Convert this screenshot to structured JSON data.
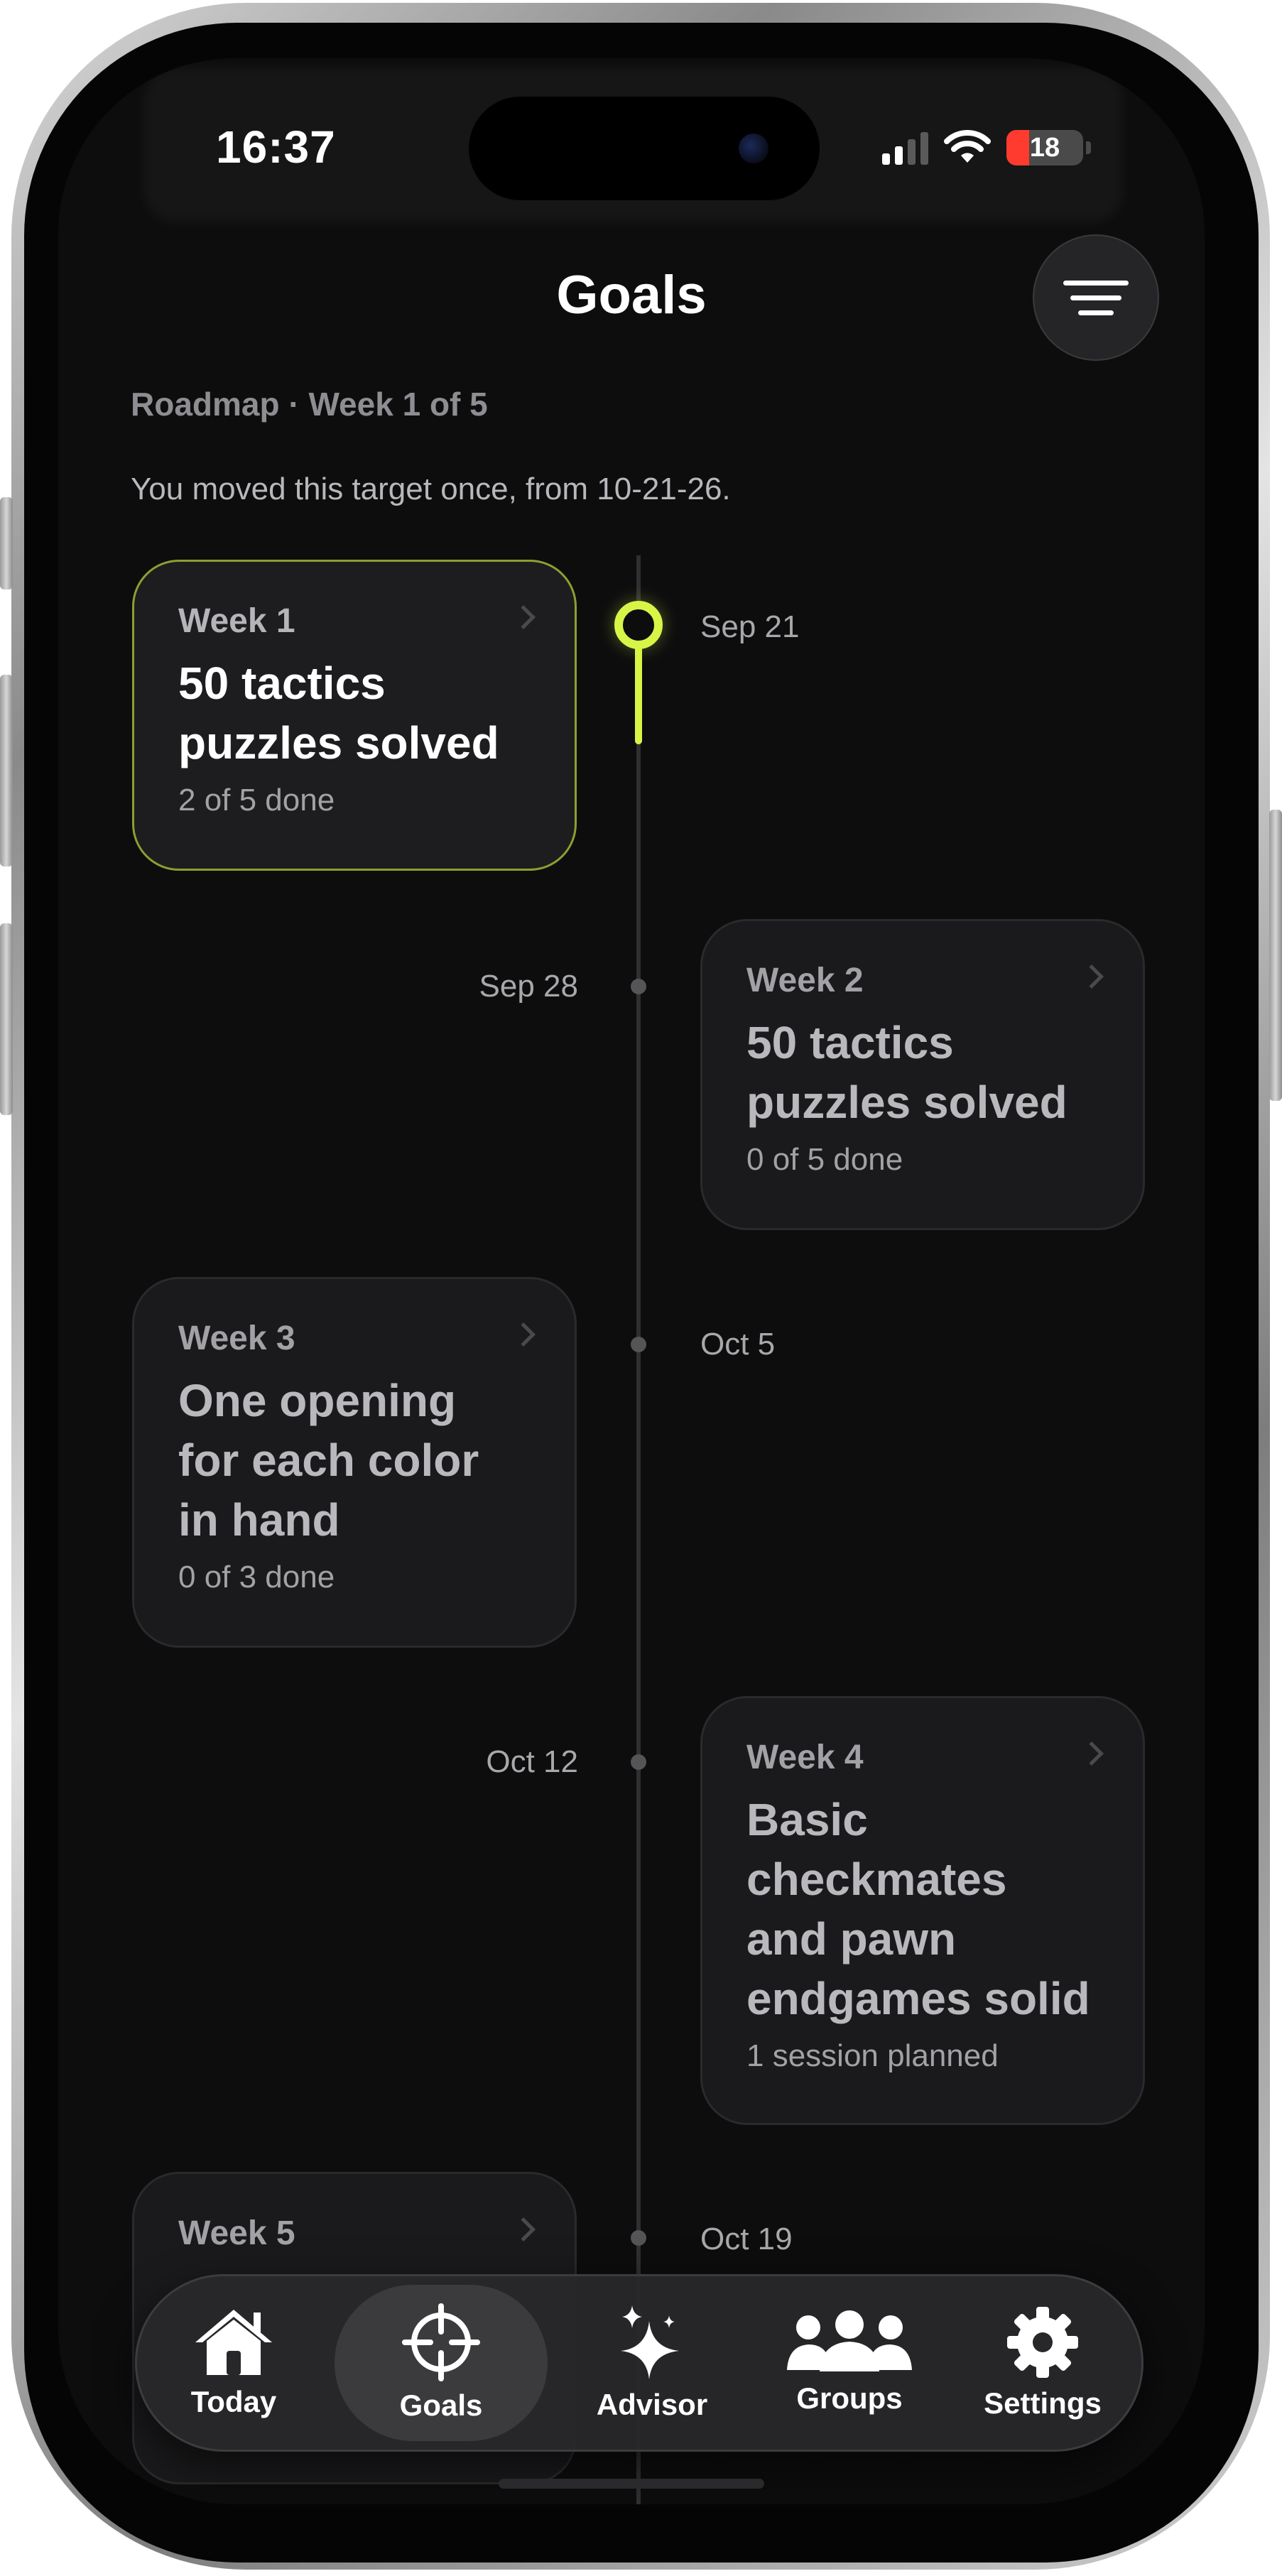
{
  "status_bar": {
    "time": "16:37",
    "battery": "18",
    "icons": [
      "cellular-signal-icon",
      "wifi-icon",
      "battery-icon"
    ]
  },
  "header": {
    "title": "Goals",
    "filter_icon": "filter-lines-icon"
  },
  "roadmap": {
    "subtitle": "Roadmap · Week 1 of 5",
    "note": "You moved this target once, from 10-21-26."
  },
  "weeks": [
    {
      "week": "Week 1",
      "title_lines": [
        "50 tactics",
        "puzzles solved"
      ],
      "progress": "2 of 5 done",
      "date": "Sep 21",
      "current": true
    },
    {
      "week": "Week 2",
      "title_lines": [
        "50 tactics",
        "puzzles solved"
      ],
      "progress": "0 of 5 done",
      "date": "Sep 28",
      "current": false
    },
    {
      "week": "Week 3",
      "title_lines": [
        "One opening",
        "for each color",
        "in hand"
      ],
      "progress": "0 of 3 done",
      "date": "Oct 5",
      "current": false
    },
    {
      "week": "Week 4",
      "title_lines": [
        "Basic",
        "checkmates",
        "and pawn",
        "endgames solid"
      ],
      "progress": "1 session planned",
      "date": "Oct 12",
      "current": false
    },
    {
      "week": "Week 5",
      "date": "Oct 19",
      "current": false
    }
  ],
  "tabbar": {
    "tabs": [
      {
        "label": "Today",
        "icon": "home-icon",
        "active": false
      },
      {
        "label": "Goals",
        "icon": "crosshair-target-icon",
        "active": true
      },
      {
        "label": "Advisor",
        "icon": "sparkles-icon",
        "active": false
      },
      {
        "label": "Groups",
        "icon": "group-people-icon",
        "active": false
      },
      {
        "label": "Settings",
        "icon": "gear-icon",
        "active": false
      }
    ]
  },
  "colors": {
    "accent": "#d7f547",
    "background": "#0d0d0e",
    "card": "#1a1a1c"
  }
}
